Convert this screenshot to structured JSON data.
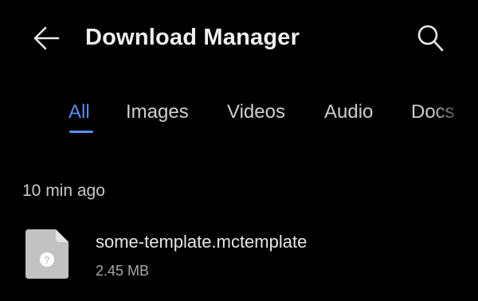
{
  "app_bar": {
    "title": "Download Manager",
    "back_icon": "back-arrow-icon",
    "search_icon": "search-icon"
  },
  "tabs": [
    {
      "label": "All",
      "active": true
    },
    {
      "label": "Images",
      "active": false
    },
    {
      "label": "Videos",
      "active": false
    },
    {
      "label": "Audio",
      "active": false
    },
    {
      "label": "Docs",
      "active": false
    }
  ],
  "sections": [
    {
      "header": "10 min ago",
      "files": [
        {
          "name": "some-template.mctemplate",
          "size": "2.45 MB",
          "icon": "unknown-file-icon"
        }
      ]
    }
  ],
  "colors": {
    "background": "#000000",
    "accent": "#5c8cef",
    "text_primary": "#e6e6e6",
    "text_secondary": "#a8a8a8",
    "file_icon": "#c2c2c2"
  }
}
